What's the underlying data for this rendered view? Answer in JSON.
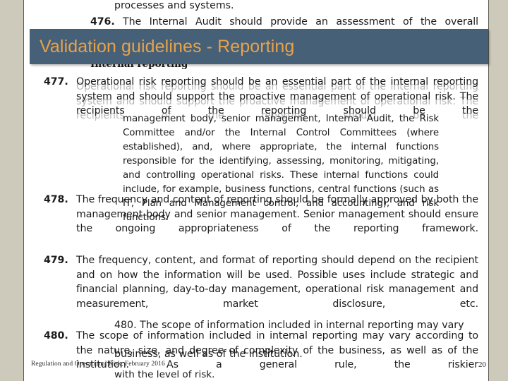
{
  "slide": {
    "title": "Validation guidelines - Reporting",
    "title_bg": "#466077",
    "title_color": "#e8a24a",
    "band_color": "#cdcabb",
    "page_number": "20",
    "footer": "Regulation and Operational Risk, February 2016"
  },
  "document": {
    "heading": "Internal reporting",
    "top_fragment": "processes and systems.",
    "paragraphs": [
      {
        "number": "476.",
        "text": "The Internal Audit should provide an assessment of the overall"
      },
      {
        "number": "477.",
        "text": "Operational risk reporting should be an essential part of the internal reporting system and should support the proactive management of operational risk. The recipients of the reporting should be the"
      },
      {
        "number": "477b",
        "text": "management body, senior management, Internal Audit, the Risk Committee and/or the Internal Control Committees (where established), and, where appropriate, the internal functions responsible for the identifying, assessing, monitoring, mitigating, and controlling operational risks. These internal functions could include, for example, business functions, central functions (such as IT, Plan and Management control, and accounting), and risk functions."
      },
      {
        "number": "478.",
        "text": "The frequency and content of reporting should be formally approved by both the management body and senior management. Senior management should ensure the ongoing appropriateness of the reporting framework."
      },
      {
        "number": "479.",
        "text": "The frequency, content, and format of reporting should depend on the recipient and on how the information will be used. Possible uses include strategic and financial planning, day-to-day management, operational risk management and measurement, market disclosure, etc."
      },
      {
        "number": "480.",
        "text": "The scope of information included in internal reporting may vary according to the nature, size, and degree of complexity of the business, as well as of the institution. As a general rule, the riskier"
      }
    ],
    "ghost": {
      "line_480_echo": "480.   The scope of information included in internal reporting may vary",
      "tail_line": "with the level of risk.",
      "overlap_line": "business, as well as of the institution.",
      "overlap_tail": "As a general rule, the riskier",
      "partial_top": "and processes and systems."
    }
  }
}
